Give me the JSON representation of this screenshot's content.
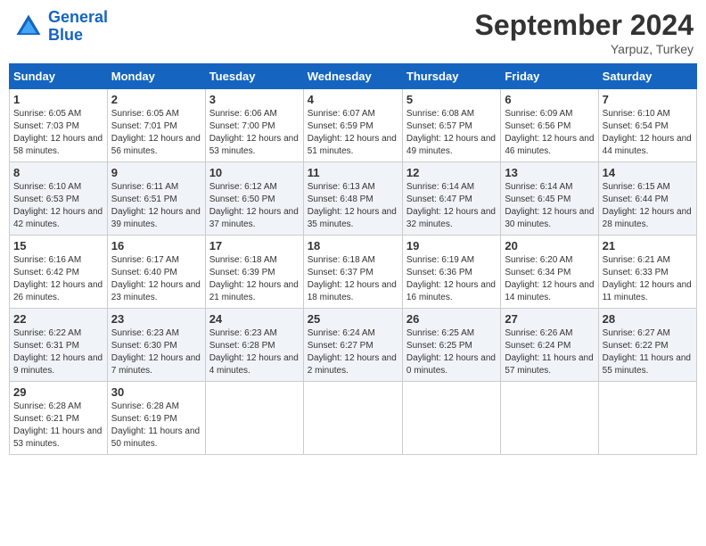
{
  "header": {
    "logo_line1": "General",
    "logo_line2": "Blue",
    "month": "September 2024",
    "location": "Yarpuz, Turkey"
  },
  "weekdays": [
    "Sunday",
    "Monday",
    "Tuesday",
    "Wednesday",
    "Thursday",
    "Friday",
    "Saturday"
  ],
  "weeks": [
    [
      {
        "day": "1",
        "info": "Sunrise: 6:05 AM\nSunset: 7:03 PM\nDaylight: 12 hours and 58 minutes."
      },
      {
        "day": "2",
        "info": "Sunrise: 6:05 AM\nSunset: 7:01 PM\nDaylight: 12 hours and 56 minutes."
      },
      {
        "day": "3",
        "info": "Sunrise: 6:06 AM\nSunset: 7:00 PM\nDaylight: 12 hours and 53 minutes."
      },
      {
        "day": "4",
        "info": "Sunrise: 6:07 AM\nSunset: 6:59 PM\nDaylight: 12 hours and 51 minutes."
      },
      {
        "day": "5",
        "info": "Sunrise: 6:08 AM\nSunset: 6:57 PM\nDaylight: 12 hours and 49 minutes."
      },
      {
        "day": "6",
        "info": "Sunrise: 6:09 AM\nSunset: 6:56 PM\nDaylight: 12 hours and 46 minutes."
      },
      {
        "day": "7",
        "info": "Sunrise: 6:10 AM\nSunset: 6:54 PM\nDaylight: 12 hours and 44 minutes."
      }
    ],
    [
      {
        "day": "8",
        "info": "Sunrise: 6:10 AM\nSunset: 6:53 PM\nDaylight: 12 hours and 42 minutes."
      },
      {
        "day": "9",
        "info": "Sunrise: 6:11 AM\nSunset: 6:51 PM\nDaylight: 12 hours and 39 minutes."
      },
      {
        "day": "10",
        "info": "Sunrise: 6:12 AM\nSunset: 6:50 PM\nDaylight: 12 hours and 37 minutes."
      },
      {
        "day": "11",
        "info": "Sunrise: 6:13 AM\nSunset: 6:48 PM\nDaylight: 12 hours and 35 minutes."
      },
      {
        "day": "12",
        "info": "Sunrise: 6:14 AM\nSunset: 6:47 PM\nDaylight: 12 hours and 32 minutes."
      },
      {
        "day": "13",
        "info": "Sunrise: 6:14 AM\nSunset: 6:45 PM\nDaylight: 12 hours and 30 minutes."
      },
      {
        "day": "14",
        "info": "Sunrise: 6:15 AM\nSunset: 6:44 PM\nDaylight: 12 hours and 28 minutes."
      }
    ],
    [
      {
        "day": "15",
        "info": "Sunrise: 6:16 AM\nSunset: 6:42 PM\nDaylight: 12 hours and 26 minutes."
      },
      {
        "day": "16",
        "info": "Sunrise: 6:17 AM\nSunset: 6:40 PM\nDaylight: 12 hours and 23 minutes."
      },
      {
        "day": "17",
        "info": "Sunrise: 6:18 AM\nSunset: 6:39 PM\nDaylight: 12 hours and 21 minutes."
      },
      {
        "day": "18",
        "info": "Sunrise: 6:18 AM\nSunset: 6:37 PM\nDaylight: 12 hours and 18 minutes."
      },
      {
        "day": "19",
        "info": "Sunrise: 6:19 AM\nSunset: 6:36 PM\nDaylight: 12 hours and 16 minutes."
      },
      {
        "day": "20",
        "info": "Sunrise: 6:20 AM\nSunset: 6:34 PM\nDaylight: 12 hours and 14 minutes."
      },
      {
        "day": "21",
        "info": "Sunrise: 6:21 AM\nSunset: 6:33 PM\nDaylight: 12 hours and 11 minutes."
      }
    ],
    [
      {
        "day": "22",
        "info": "Sunrise: 6:22 AM\nSunset: 6:31 PM\nDaylight: 12 hours and 9 minutes."
      },
      {
        "day": "23",
        "info": "Sunrise: 6:23 AM\nSunset: 6:30 PM\nDaylight: 12 hours and 7 minutes."
      },
      {
        "day": "24",
        "info": "Sunrise: 6:23 AM\nSunset: 6:28 PM\nDaylight: 12 hours and 4 minutes."
      },
      {
        "day": "25",
        "info": "Sunrise: 6:24 AM\nSunset: 6:27 PM\nDaylight: 12 hours and 2 minutes."
      },
      {
        "day": "26",
        "info": "Sunrise: 6:25 AM\nSunset: 6:25 PM\nDaylight: 12 hours and 0 minutes."
      },
      {
        "day": "27",
        "info": "Sunrise: 6:26 AM\nSunset: 6:24 PM\nDaylight: 11 hours and 57 minutes."
      },
      {
        "day": "28",
        "info": "Sunrise: 6:27 AM\nSunset: 6:22 PM\nDaylight: 11 hours and 55 minutes."
      }
    ],
    [
      {
        "day": "29",
        "info": "Sunrise: 6:28 AM\nSunset: 6:21 PM\nDaylight: 11 hours and 53 minutes."
      },
      {
        "day": "30",
        "info": "Sunrise: 6:28 AM\nSunset: 6:19 PM\nDaylight: 11 hours and 50 minutes."
      },
      {
        "day": "",
        "info": ""
      },
      {
        "day": "",
        "info": ""
      },
      {
        "day": "",
        "info": ""
      },
      {
        "day": "",
        "info": ""
      },
      {
        "day": "",
        "info": ""
      }
    ]
  ]
}
